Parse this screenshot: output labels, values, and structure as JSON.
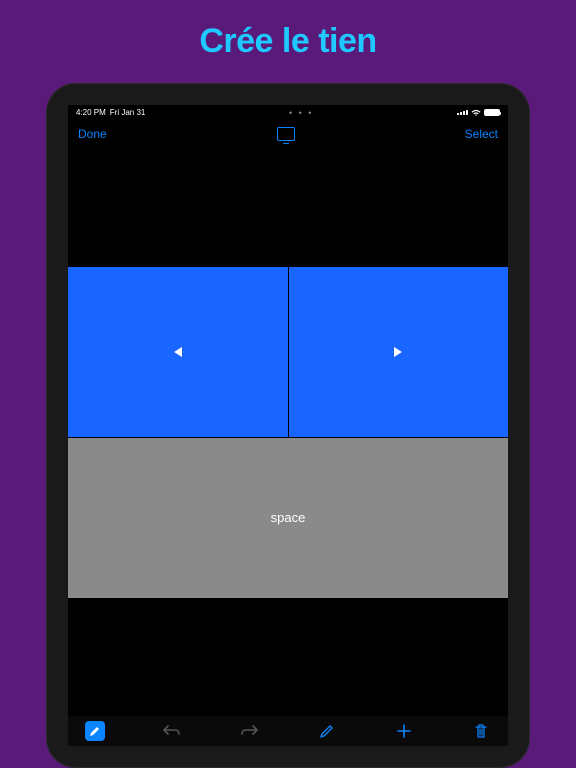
{
  "headline": "Crée le tien",
  "status": {
    "time": "4:20 PM",
    "date": "Fri Jan 31",
    "dots": "• • •"
  },
  "nav": {
    "done": "Done",
    "select": "Select"
  },
  "controls": {
    "space_label": "space"
  },
  "colors": {
    "background": "#5a1a7a",
    "accent": "#1fc8ff",
    "ios_blue": "#0a84ff",
    "pad_blue": "#1a64ff",
    "space_gray": "#8a8a8a"
  }
}
